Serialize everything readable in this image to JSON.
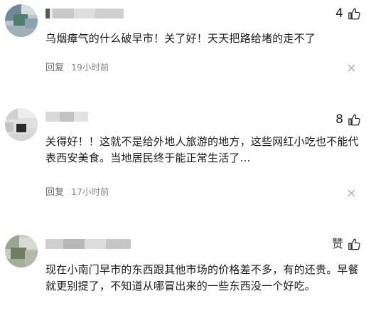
{
  "comments": [
    {
      "likes": "4",
      "text": "乌烟瘴气的什么破早市！关了好！天天把路给堵的走不了",
      "reply_label": "回复",
      "time": "19小时前"
    },
    {
      "likes": "8",
      "text": "关得好！！这就不是给外地人旅游的地方，这些网红小吃也不能代表西安美食。当地居民终于能正常生活了...",
      "reply_label": "回复",
      "time": "17小时前"
    },
    {
      "likes": "赞",
      "text": "现在小南门早市的东西跟其他市场的价格差不多，有的还贵。早餐就更别提了，不知道从哪冒出来的一些东西没一个好吃。"
    }
  ],
  "icons": {
    "like": "thumbs-up-icon",
    "close": "close-icon"
  },
  "colors": {
    "text": "#1a1a1a",
    "meta": "#888888",
    "blur_gray": "#bfbfbf"
  }
}
